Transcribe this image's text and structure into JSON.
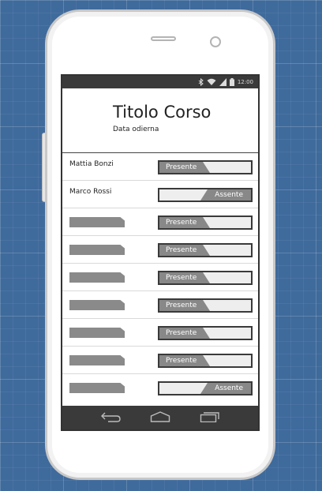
{
  "status_bar": {
    "time": "12:00",
    "icons": [
      "bluetooth-icon",
      "wifi-icon",
      "signal-icon",
      "battery-icon"
    ]
  },
  "header": {
    "title": "Titolo Corso",
    "subtitle": "Data odierna"
  },
  "students": [
    {
      "name": "Mattia Bonzi",
      "status": "Presente",
      "present": true,
      "placeholder": false
    },
    {
      "name": "Marco Rossi",
      "status": "Assente",
      "present": false,
      "placeholder": false
    },
    {
      "name": "",
      "status": "Presente",
      "present": true,
      "placeholder": true
    },
    {
      "name": "",
      "status": "Presente",
      "present": true,
      "placeholder": true
    },
    {
      "name": "",
      "status": "Presente",
      "present": true,
      "placeholder": true
    },
    {
      "name": "",
      "status": "Presente",
      "present": true,
      "placeholder": true
    },
    {
      "name": "",
      "status": "Presente",
      "present": true,
      "placeholder": true
    },
    {
      "name": "",
      "status": "Presente",
      "present": true,
      "placeholder": true
    },
    {
      "name": "",
      "status": "Assente",
      "present": false,
      "placeholder": true
    }
  ],
  "nav_bar": {
    "icons": [
      "back-icon",
      "home-icon",
      "recent-apps-icon"
    ]
  },
  "colors": {
    "background": "#3f6a9c",
    "bar": "#3a3a3a",
    "knob": "#888888"
  }
}
